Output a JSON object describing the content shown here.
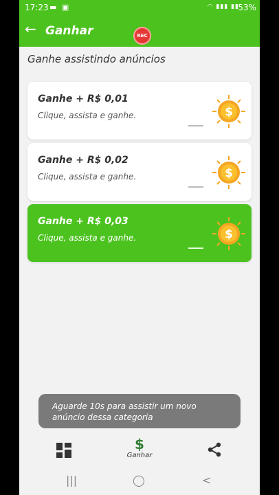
{
  "status": {
    "time": "17:23",
    "left_icons": "▬ ▣",
    "right_icons": "◠ ▮▮▮ ▮▮",
    "battery": "53%"
  },
  "appbar": {
    "back_icon": "←",
    "title": "Ganhar",
    "rec_label": "REC"
  },
  "section_title": "Ganhe assistindo anúncios",
  "cards": [
    {
      "title": "Ganhe + R$ 0,01",
      "subtitle": "Clique, assista e ganhe."
    },
    {
      "title": "Ganhe + R$ 0,02",
      "subtitle": "Clique, assista e ganhe."
    },
    {
      "title": "Ganhe + R$ 0,03",
      "subtitle": "Clique, assista e ganhe."
    }
  ],
  "toast": "Aguarde 10s para assistir um novo anúncio dessa categoria",
  "bottom_nav": {
    "earn_icon": "$",
    "earn_label": "Ganhar"
  },
  "system_nav": {
    "recents": "|||",
    "home": "◯",
    "back": "<"
  },
  "colors": {
    "primary_green": "#4cc21f",
    "coin_gold": "#f5a623",
    "toast_bg": "#7a7a7a"
  },
  "icons": [
    "back-arrow-icon",
    "rec-icon",
    "coin-icon",
    "grid-icon",
    "dollar-icon",
    "share-icon"
  ]
}
